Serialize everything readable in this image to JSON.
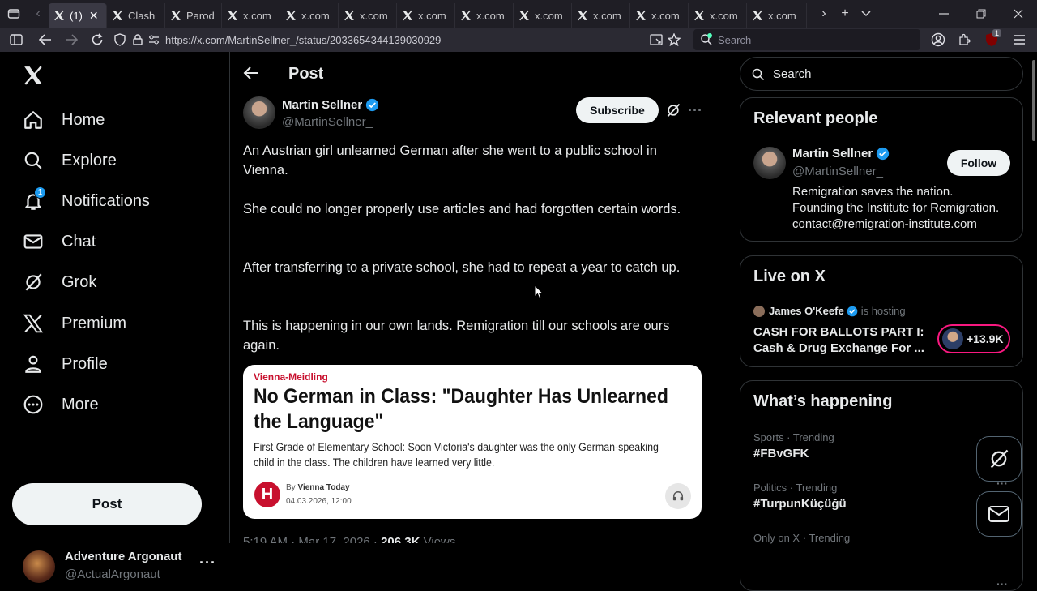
{
  "browser": {
    "tabs": [
      {
        "label": "(1)",
        "active": true
      },
      {
        "label": "Clash"
      },
      {
        "label": "Parod"
      },
      {
        "label": "x.com"
      },
      {
        "label": "x.com"
      },
      {
        "label": "x.com"
      },
      {
        "label": "x.com"
      },
      {
        "label": "x.com"
      },
      {
        "label": "x.com"
      },
      {
        "label": "x.com"
      },
      {
        "label": "x.com"
      },
      {
        "label": "x.com"
      },
      {
        "label": "x.com"
      }
    ],
    "url": "https://x.com/MartinSellner_/status/2033654344139030929",
    "search_placeholder": "Search",
    "extension_badge": "1"
  },
  "sidebar": {
    "items": [
      {
        "label": "Home",
        "icon": "home-icon"
      },
      {
        "label": "Explore",
        "icon": "search-icon"
      },
      {
        "label": "Notifications",
        "icon": "bell-icon",
        "badge": "1"
      },
      {
        "label": "Chat",
        "icon": "mail-icon"
      },
      {
        "label": "Grok",
        "icon": "grok-icon"
      },
      {
        "label": "Premium",
        "icon": "x-logo-icon"
      },
      {
        "label": "Profile",
        "icon": "person-icon"
      },
      {
        "label": "More",
        "icon": "more-circle-icon"
      }
    ],
    "post_label": "Post",
    "account": {
      "name": "Adventure Argonaut",
      "handle": "@ActualArgonaut"
    }
  },
  "main": {
    "header_title": "Post",
    "author": {
      "name": "Martin Sellner",
      "handle": "@MartinSellner_"
    },
    "subscribe_label": "Subscribe",
    "paragraphs": [
      "An Austrian girl unlearned German after she went to a public school in Vienna.",
      "She could no longer properly use articles and had forgotten certain words.",
      "After transferring to a private school, she had to repeat a year to catch up.",
      "This is happening in our own lands. Remigration till our schools are ours again."
    ],
    "article": {
      "kicker": "Vienna-Meidling",
      "headline": "No German in Class: \"Daughter Has Unlearned the Language\"",
      "summary": "First Grade of Elementary School: Soon Victoria's daughter was the only German-speaking child in the class. The children have learned very little.",
      "by_prefix": "By",
      "source": "Vienna Today",
      "date": "04.03.2026, 12:00",
      "logo_letter": "H"
    },
    "meta": {
      "time": "5:19 AM · Mar 17, 2026 · ",
      "views": "206.3K",
      "views_label": " Views"
    }
  },
  "right": {
    "search_placeholder": "Search",
    "relevant": {
      "title": "Relevant people",
      "name": "Martin Sellner",
      "handle": "@MartinSellner_",
      "follow_label": "Follow",
      "bio_lines": [
        "Remigration saves the nation.",
        "Founding the Institute for Remigration.",
        "contact@remigration-institute.com"
      ]
    },
    "live": {
      "title": "Live on X",
      "host": "James O'Keefe",
      "hosting_label": "is hosting",
      "headline_line1": "CASH FOR BALLOTS PART I:",
      "headline_line2": "Cash & Drug Exchange For ...",
      "listeners": "+13.9K"
    },
    "happening": {
      "title": "What’s happening",
      "items": [
        {
          "meta": "Sports · Trending",
          "tag": "#FBvGFK"
        },
        {
          "meta": "Politics · Trending",
          "tag": "#TurpunKüçüğü"
        },
        {
          "meta": "Only on X · Trending",
          "tag": ""
        }
      ]
    }
  },
  "colors": {
    "accent": "#1d9bf0",
    "verified": "#1d9bf0",
    "live_ring": "#f91880",
    "article_red": "#c8102e"
  }
}
